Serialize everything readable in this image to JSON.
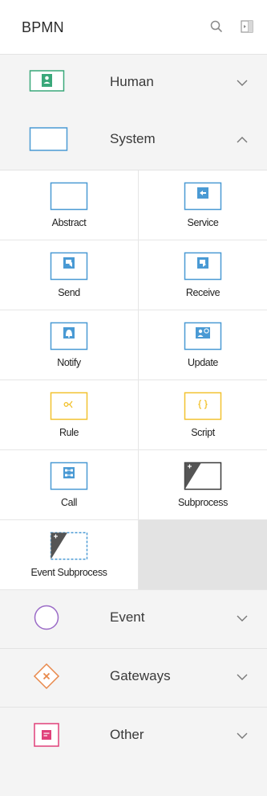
{
  "header": {
    "title": "BPMN",
    "search_icon": "search-icon",
    "panel_icon": "collapse-panel-icon"
  },
  "categories": {
    "human": {
      "label": "Human",
      "icon": "human-task-icon",
      "state": "collapsed"
    },
    "system": {
      "label": "System",
      "icon": "system-task-icon",
      "state": "expanded"
    },
    "event": {
      "label": "Event",
      "icon": "event-circle-icon",
      "state": "collapsed"
    },
    "gateways": {
      "label": "Gateways",
      "icon": "gateway-diamond-icon",
      "state": "collapsed"
    },
    "other": {
      "label": "Other",
      "icon": "other-note-icon",
      "state": "collapsed"
    }
  },
  "system_items": [
    {
      "label": "Abstract",
      "icon": "abstract-task-icon"
    },
    {
      "label": "Service",
      "icon": "service-task-icon"
    },
    {
      "label": "Send",
      "icon": "send-task-icon"
    },
    {
      "label": "Receive",
      "icon": "receive-task-icon"
    },
    {
      "label": "Notify",
      "icon": "notify-task-icon"
    },
    {
      "label": "Update",
      "icon": "update-task-icon"
    },
    {
      "label": "Rule",
      "icon": "rule-task-icon"
    },
    {
      "label": "Script",
      "icon": "script-task-icon"
    },
    {
      "label": "Call",
      "icon": "call-activity-icon"
    },
    {
      "label": "Subprocess",
      "icon": "subprocess-icon"
    },
    {
      "label": "Event Subprocess",
      "icon": "event-subprocess-icon"
    }
  ],
  "colors": {
    "human": "#3aa87a",
    "system": "#4a9ad4",
    "rule": "#f2c230",
    "event": "#9b6bc7",
    "gateway": "#e8884a",
    "other": "#e0407a"
  }
}
